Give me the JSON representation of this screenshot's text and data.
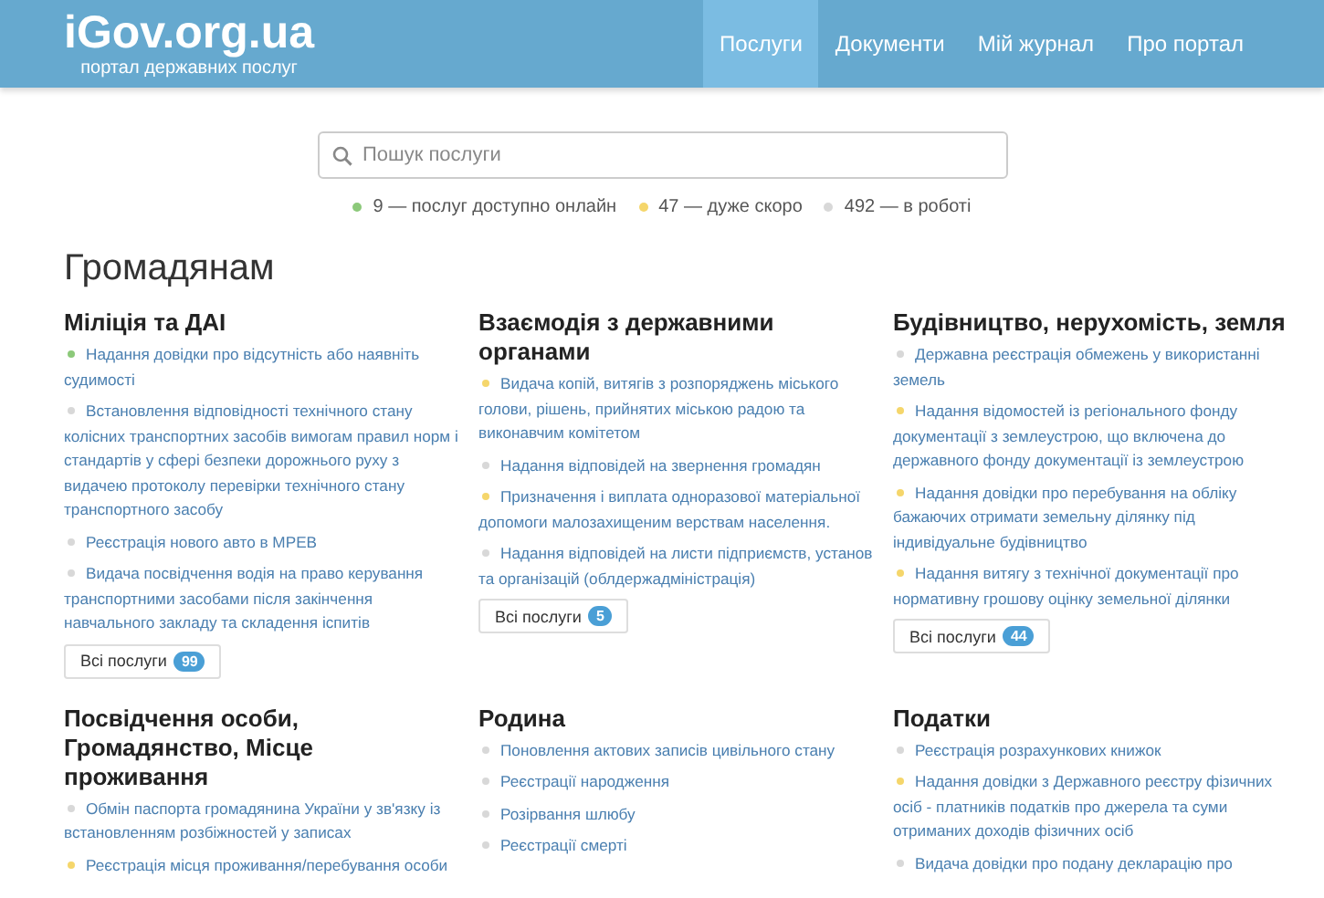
{
  "header": {
    "logo": "iGov.org.ua",
    "tagline": "портал державних послуг",
    "nav": [
      {
        "label": "Послуги",
        "selected": true
      },
      {
        "label": "Документи",
        "selected": false
      },
      {
        "label": "Мій журнал",
        "selected": false
      },
      {
        "label": "Про портал",
        "selected": false
      }
    ]
  },
  "search": {
    "placeholder": "Пошук послуги"
  },
  "stats": [
    {
      "text": "9 — послуг доступно онлайн",
      "color": "#8cc97a"
    },
    {
      "text": "47 — дуже скоро",
      "color": "#f5d66b"
    },
    {
      "text": "492 — в роботі",
      "color": "#d8d8d8"
    }
  ],
  "heading": "Громадянам",
  "sections": [
    {
      "title": "Міліція та ДАІ",
      "items": [
        {
          "text": "Надання довідки про відсутність або наявніть судимості",
          "color": "#8cc97a"
        },
        {
          "text": "Встановлення відповідності технічного стану колісних транспортних засобів вимогам правил норм і стандартів у сфері безпеки дорожнього руху з видачею протоколу перевірки технічного стану транспортного засобу",
          "color": "#d8d8d8"
        },
        {
          "text": "Реєстрація нового авто в МРЕВ",
          "color": "#d8d8d8"
        },
        {
          "text": "Видача посвідчення водія на право керування транспортними засобами після закінчення навчального закладу та складення іспитів",
          "color": "#d8d8d8"
        }
      ],
      "all_button": {
        "label": "Всі послуги",
        "count": "99"
      }
    },
    {
      "title": "Взаємодія з державними органами",
      "items": [
        {
          "text": "Видача копій, витягів з розпоряджень міського голови, рішень, прийнятих міською радою та виконавчим комітетом",
          "color": "#f5d66b"
        },
        {
          "text": "Надання відповідей на звернення громадян",
          "color": "#d8d8d8"
        },
        {
          "text": "Призначення і виплата одноразової матеріальної допомоги малозахищеним верствам населення.",
          "color": "#f5d66b"
        },
        {
          "text": "Надання відповідей на листи підприємств, установ та організацій (облдержадміністрація)",
          "color": "#d8d8d8"
        }
      ],
      "all_button": {
        "label": "Всі послуги",
        "count": "5"
      }
    },
    {
      "title": "Будівництво, нерухомість, земля",
      "items": [
        {
          "text": "Державна реєстрація обмежень у використанні земель",
          "color": "#d8d8d8"
        },
        {
          "text": "Надання відомостей із регіонального фонду документації з землеустрою, що включена до державного фонду документації із землеустрою",
          "color": "#f5d66b"
        },
        {
          "text": "Надання довідки про перебування на обліку бажаючих отримати земельну ділянку під індивідуальне будівництво",
          "color": "#f5d66b"
        },
        {
          "text": "Надання витягу з технічної документації про нормативну грошову оцінку земельної ділянки",
          "color": "#f5d66b"
        }
      ],
      "all_button": {
        "label": "Всі послуги",
        "count": "44"
      }
    },
    {
      "title": "Посвідчення особи, Громадянство, Місце проживання",
      "items": [
        {
          "text": "Обмін паспорта громадянина України у зв'язку із встановленням розбіжностей у записах",
          "color": "#d8d8d8"
        },
        {
          "text": "Реєстрація місця проживання/перебування особи",
          "color": "#f5d66b"
        }
      ]
    },
    {
      "title": "Родина",
      "items": [
        {
          "text": "Поновлення актових записів цивільного стану",
          "color": "#d8d8d8"
        },
        {
          "text": "Реєстрації народження",
          "color": "#d8d8d8"
        },
        {
          "text": "Розірвання шлюбу",
          "color": "#d8d8d8"
        },
        {
          "text": "Реєстрації смерті",
          "color": "#d8d8d8"
        }
      ]
    },
    {
      "title": "Податки",
      "items": [
        {
          "text": "Реєстрація розрахункових книжок",
          "color": "#d8d8d8"
        },
        {
          "text": "Надання довідки з Державного реєстру фізичних осіб - платників податків про джерела та суми отриманих доходів фізичних осіб",
          "color": "#f5d66b"
        },
        {
          "text": "Видача довідки про подану декларацію про",
          "color": "#d8d8d8"
        }
      ]
    }
  ]
}
